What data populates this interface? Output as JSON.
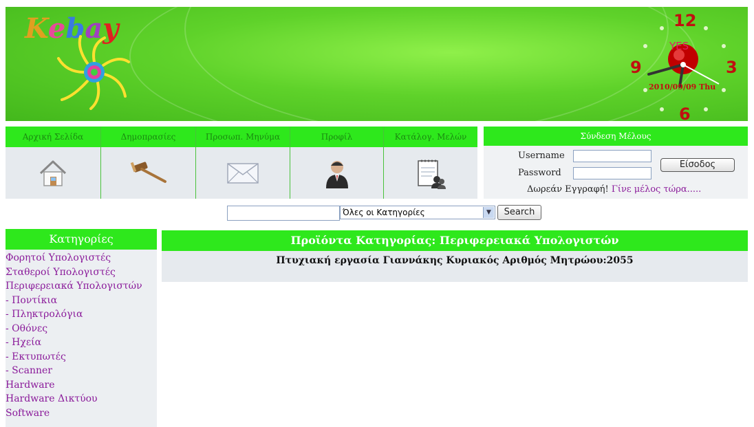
{
  "banner": {
    "logo_letters": [
      "K",
      "e",
      "b",
      "a",
      "y"
    ],
    "clock": {
      "numbers": {
        "n12": "12",
        "n3": "3",
        "n6": "6",
        "n9": "9"
      },
      "date": "2010/09/09 Thu",
      "center_text": "YES"
    }
  },
  "nav": {
    "items": [
      {
        "label": "Αρχική Σελίδα",
        "icon": "house-icon"
      },
      {
        "label": "Δημοπρασίες",
        "icon": "gavel-icon"
      },
      {
        "label": "Προσωπ. Μηνύμα",
        "icon": "envelope-icon"
      },
      {
        "label": "Προφίλ",
        "icon": "user-icon"
      },
      {
        "label": "Κατάλογ. Μελών",
        "icon": "notepad-icon"
      }
    ]
  },
  "login": {
    "title": "Σύνδεση Μέλους",
    "username_label": "Username",
    "password_label": "Password",
    "username_value": "",
    "password_value": "",
    "submit_label": "Είσοδος",
    "register_text": "Δωρεάν Εγγραφή!",
    "register_link": "Γίνε μέλος τώρα....."
  },
  "search": {
    "query": "",
    "category_selected": "Όλες οι Κατηγορίες",
    "button_label": "Search"
  },
  "categories": {
    "title": "Κατηγορίες",
    "items": [
      "Φορητοί Υπολογιστές",
      "Σταθεροί Υπολογιστές",
      "Περιφερειακά Υπολογιστών",
      "- Ποντίκια",
      "- Πληκτρολόγια",
      "- Οθόνες",
      "- Ηχεία",
      "- Εκτυπωτές",
      "- Scanner",
      "Hardware",
      "Hardware Δικτύου",
      "Software"
    ]
  },
  "content": {
    "title": "Προϊόντα Κατηγορίας: Περιφερειακά Υπολογιστών",
    "text": "Πτυχιακή εργασία Γιαννάκης Κυριακός Αριθμός Μητρώου:2055"
  },
  "colors": {
    "accent_green": "#2ee81c",
    "link_purple": "#8a1a9a",
    "panel_gray": "#e6eaee"
  }
}
